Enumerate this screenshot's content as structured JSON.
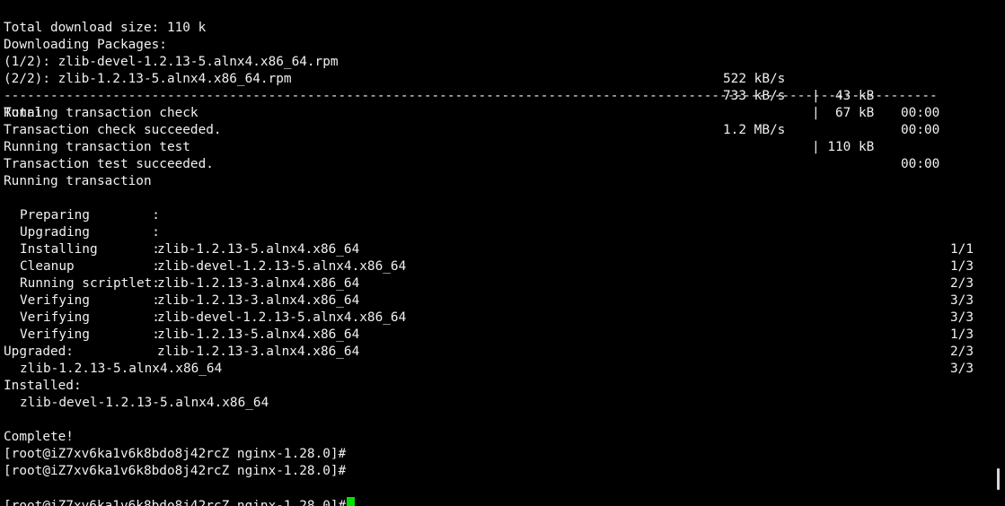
{
  "colors": {
    "background": "#000000",
    "text": "#f0f0f0",
    "cursor": "#00e000",
    "scrollbar": "#d8d8d8"
  },
  "header": {
    "total_download": "Total download size: 110 k",
    "downloading": "Downloading Packages:"
  },
  "downloads": [
    {
      "name": "(1/2): zlib-devel-1.2.13-5.alnx4.x86_64.rpm",
      "speed": "522 kB/s",
      "size": "|  43 kB",
      "time": "00:00"
    },
    {
      "name": "(2/2): zlib-1.2.13-5.alnx4.x86_64.rpm",
      "speed": "733 kB/s",
      "size": "|  67 kB",
      "time": "00:00"
    }
  ],
  "separator": "------------------------------------------------------------------------------------------------------------------------",
  "total": {
    "name": "Total",
    "speed": "1.2 MB/s",
    "size": "| 110 kB",
    "time": "00:00"
  },
  "transaction_messages": [
    "Running transaction check",
    "Transaction check succeeded.",
    "Running transaction test",
    "Transaction test succeeded.",
    "Running transaction"
  ],
  "steps": [
    {
      "label": "Preparing        :",
      "pkg": "",
      "count": "1/1"
    },
    {
      "label": "Upgrading        :",
      "pkg": "zlib-1.2.13-5.alnx4.x86_64",
      "count": "1/3"
    },
    {
      "label": "Installing       :",
      "pkg": "zlib-devel-1.2.13-5.alnx4.x86_64",
      "count": "2/3"
    },
    {
      "label": "Cleanup          :",
      "pkg": "zlib-1.2.13-3.alnx4.x86_64",
      "count": "3/3"
    },
    {
      "label": "Running scriptlet:",
      "pkg": "zlib-1.2.13-3.alnx4.x86_64",
      "count": "3/3"
    },
    {
      "label": "Verifying        :",
      "pkg": "zlib-devel-1.2.13-5.alnx4.x86_64",
      "count": "1/3"
    },
    {
      "label": "Verifying        :",
      "pkg": "zlib-1.2.13-5.alnx4.x86_64",
      "count": "2/3"
    },
    {
      "label": "Verifying        :",
      "pkg": "zlib-1.2.13-3.alnx4.x86_64",
      "count": "3/3"
    }
  ],
  "summary": {
    "upgraded_label": "Upgraded:",
    "upgraded_pkg": "zlib-1.2.13-5.alnx4.x86_64",
    "installed_label": "Installed:",
    "installed_pkg": "zlib-devel-1.2.13-5.alnx4.x86_64",
    "complete": "Complete!"
  },
  "prompts": [
    "[root@iZ7xv6ka1v6k8bdo8j42rcZ nginx-1.28.0]#",
    "[root@iZ7xv6ka1v6k8bdo8j42rcZ nginx-1.28.0]#",
    "[root@iZ7xv6ka1v6k8bdo8j42rcZ nginx-1.28.0]#"
  ]
}
